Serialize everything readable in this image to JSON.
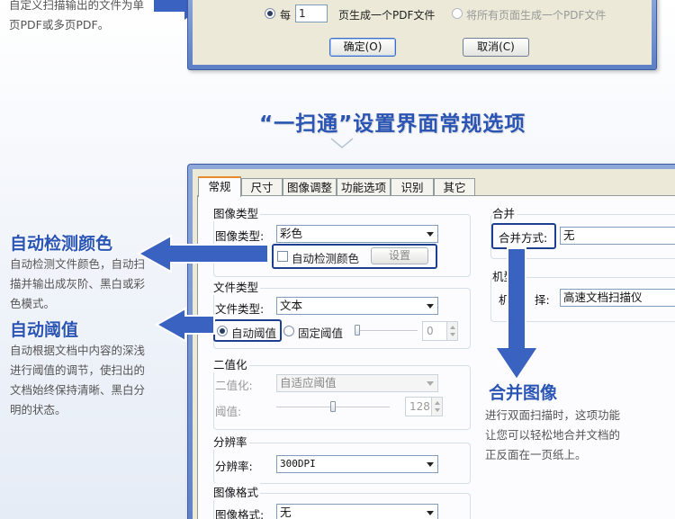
{
  "top_left_caption": {
    "line1": "自定义扫描输出的文件为单",
    "line2": "页PDF或多页PDF。"
  },
  "top_dialog": {
    "radio_each_label": "每",
    "pages_value": "1",
    "pages_suffix": "页生成一个PDF文件",
    "radio_all_label": "将所有页面生成一个PDF文件",
    "ok_button": "确定(O)",
    "cancel_button": "取消(C)"
  },
  "section_title": "“一扫通”设置界面常规选项",
  "tabs": [
    {
      "label": "常规",
      "active": true
    },
    {
      "label": "尺寸",
      "active": false
    },
    {
      "label": "图像调整",
      "active": false
    },
    {
      "label": "功能选项",
      "active": false
    },
    {
      "label": "识别",
      "active": false
    },
    {
      "label": "其它",
      "active": false
    }
  ],
  "image_type_group": {
    "title": "图像类型",
    "label": "图像类型:",
    "value": "彩色",
    "auto_detect_label": "自动检测颜色",
    "settings_button": "设置"
  },
  "file_type_group": {
    "title": "文件类型",
    "label": "文件类型:",
    "value": "文本",
    "auto_threshold_label": "自动阈值",
    "fixed_threshold_label": "固定阈值",
    "threshold_value": "0"
  },
  "binarize_group": {
    "title": "二值化",
    "binarize_label": "二值化:",
    "binarize_value": "自适应阈值",
    "threshold_label": "阈值:",
    "threshold_value": "128",
    "slider_level": 0.5
  },
  "resolution_group": {
    "title": "分辨率",
    "label": "分辨率:",
    "value": "300DPI"
  },
  "image_format_group": {
    "title": "图像格式",
    "label": "图像格式:",
    "value": "无"
  },
  "merge_group": {
    "title": "合并",
    "label": "合并方式:",
    "value": "无"
  },
  "model_group": {
    "title": "机型",
    "label_left": "机",
    "label_right": "择:",
    "value": "高速文档扫描仪"
  },
  "callouts": {
    "auto_color": {
      "heading": "自动检测颜色",
      "lines": [
        "自动检测文件颜色，自动扫",
        "描并输出成灰阶、黑白或彩",
        "色模式。"
      ]
    },
    "auto_threshold": {
      "heading": "自动阈值",
      "lines": [
        "自动根据文档中内容的深浅",
        "进行阈值的调节，使扫出的",
        "文档始终保持清晰、黑白分",
        "明的状态。"
      ]
    },
    "merge_image": {
      "heading": "合并图像",
      "lines": [
        "进行双面扫描时，这项功能",
        "让您可以轻松地合并文档的",
        "正反面在一页纸上。"
      ]
    }
  },
  "colors": {
    "accent_blue": "#2a55b4",
    "dialog_frame": "#5d7fc4",
    "tab_active_top": "#e68b2c"
  }
}
